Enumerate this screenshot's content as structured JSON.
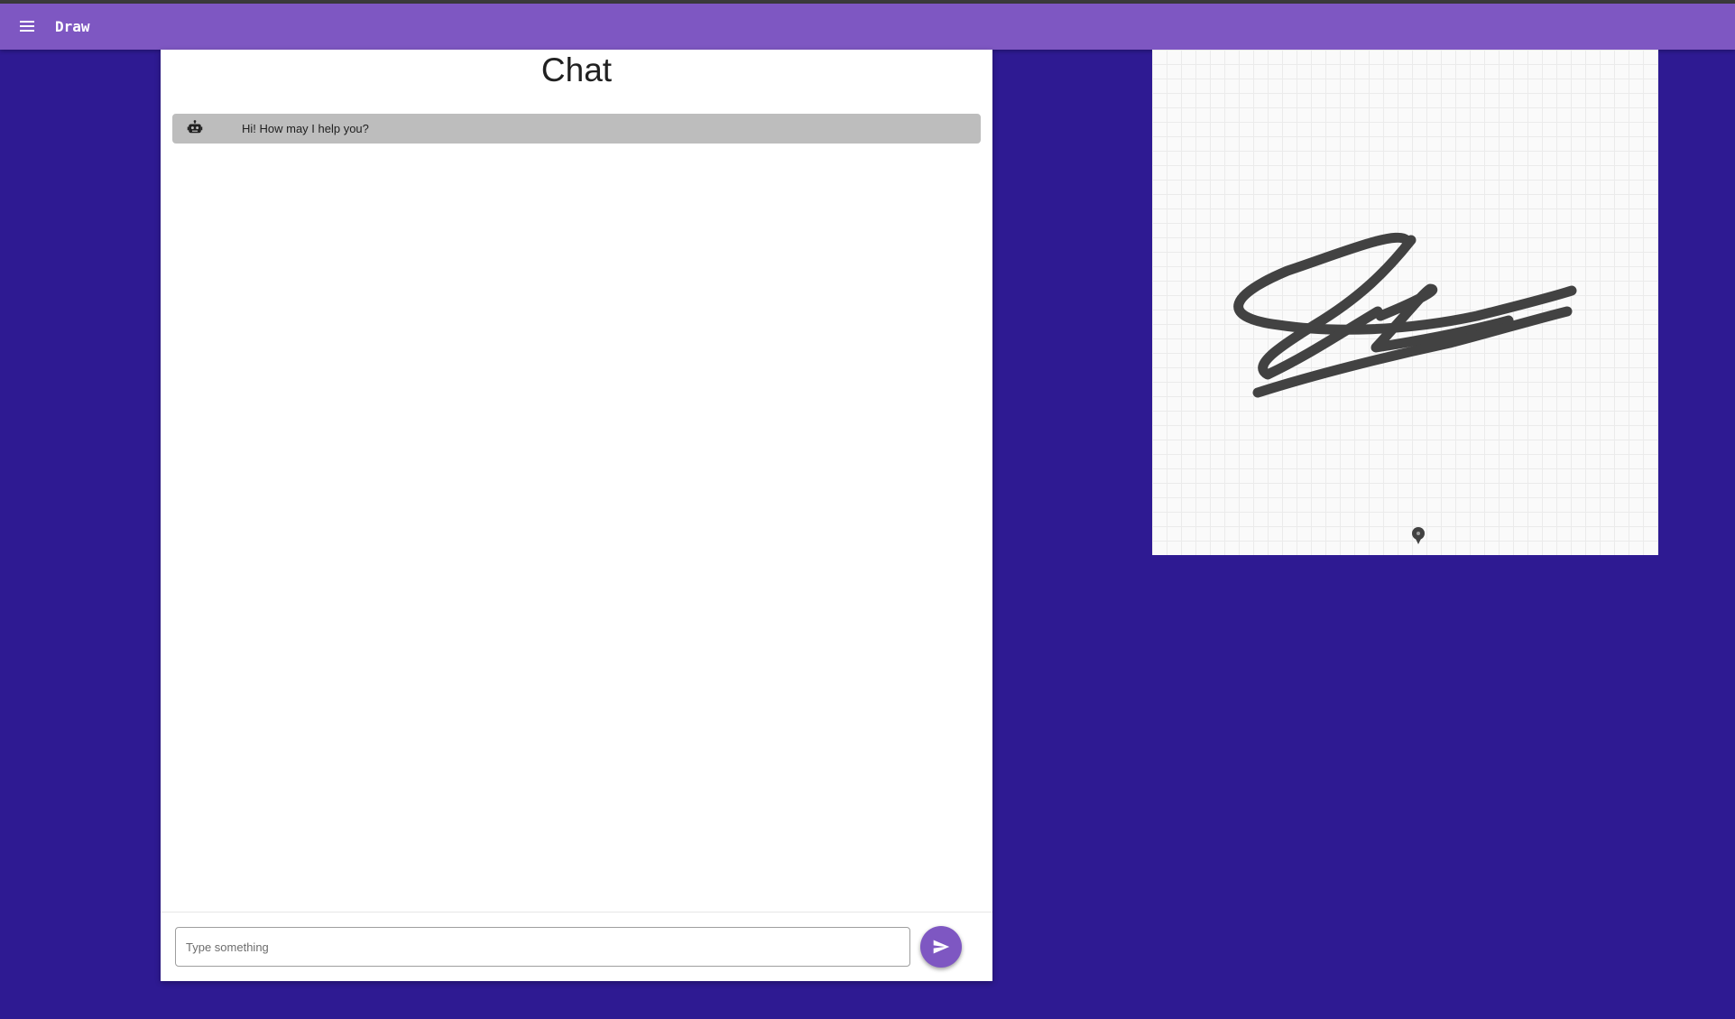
{
  "appbar": {
    "title": "Draw",
    "menu_icon": "menu-icon",
    "color": "#7e57c2"
  },
  "chat": {
    "title": "Chat",
    "messages": [
      {
        "sender": "bot",
        "icon": "robot-icon",
        "text": "Hi! How may I help you?"
      }
    ],
    "input": {
      "placeholder": "Type something",
      "value": ""
    },
    "send_icon": "send-icon"
  },
  "canvas": {
    "cursor_icon": "pen-cursor-icon"
  },
  "colors": {
    "background": "#2e1a92",
    "accent": "#7e57c2",
    "bot_bubble": "#bdbdbd",
    "stroke": "#424242"
  }
}
